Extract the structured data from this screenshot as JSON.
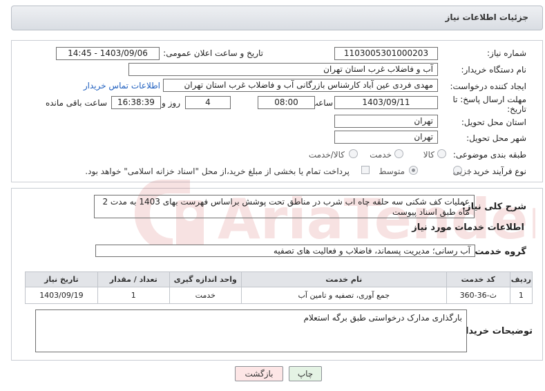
{
  "panel": {
    "title": "جزئیات اطلاعات نیاز"
  },
  "fields": {
    "need_number_label": "شماره نیاز:",
    "need_number": "1103005301000203",
    "announce_label": "تاریخ و ساعت اعلان عمومی:",
    "announce_value": "1403/09/06 - 14:45",
    "buyer_org_label": "نام دستگاه خریدار:",
    "buyer_org": "آب و فاضلاب غرب استان تهران",
    "creator_label": "ایجاد کننده درخواست:",
    "creator": "مهدی فردی عین آباد کارشناس بازرگانی آب و فاضلاب غرب استان تهران",
    "contact_link": "اطلاعات تماس خریدار",
    "deadline_label_1": "مهلت ارسال پاسخ: تا",
    "deadline_label_2": "تاریخ:",
    "deadline_date": "1403/09/11",
    "time_label": "ساعت",
    "deadline_time": "08:00",
    "days_value": "4",
    "days_label": "روز و",
    "remaining_time": "16:38:39",
    "remaining_label": "ساعت باقی مانده",
    "province_label": "استان محل تحویل:",
    "province": "تهران",
    "city_label": "شهر محل تحویل:",
    "city": "تهران",
    "category_label": "طبقه بندی موضوعی:",
    "category_options": [
      "کالا",
      "خدمت",
      "کالا/خدمت"
    ],
    "process_label": "نوع فرآیند خرید :",
    "process_options": [
      "جزیی",
      "متوسط"
    ],
    "payment_note": "پرداخت تمام یا بخشی از مبلغ خرید،از محل \"اسناد خزانه اسلامی\" خواهد بود."
  },
  "general": {
    "description_label": "شرح کلی نیاز:",
    "description": "عملیات کف شکنی سه حلقه چاه اب شرب در مناطق تحت پوشش براساس فهرست بهای 1403 به مدت 2 ماه طبق اسناد پیوست",
    "services_heading": "اطلاعات خدمات مورد نیاز",
    "service_group_label": "گروه خدمت:",
    "service_group": "آب رسانی؛ مدیریت پسماند، فاضلاب و فعالیت های تصفیه"
  },
  "table": {
    "headers": [
      "ردیف",
      "کد خدمت",
      "نام خدمت",
      "واحد اندازه گیری",
      "تعداد / مقدار",
      "تاریخ نیاز"
    ],
    "rows": [
      [
        "1",
        "ث-36-360",
        "جمع آوری، تصفیه و تامین آب",
        "خدمت",
        "1",
        "1403/09/19"
      ]
    ]
  },
  "buyer_notes": {
    "label": "توضیحات خریدار:",
    "text": "بارگذاری مدارک درخواستی طبق برگه استعلام"
  },
  "buttons": {
    "print": "چاپ",
    "back": "بازگشت"
  },
  "watermark": {
    "text": "AriaTender.neT"
  },
  "colors": {
    "link": "#1f5fbf",
    "header_bg": "#e2e4e8",
    "back_button": "#fde6e6",
    "print_button": "#e4f3e4"
  }
}
